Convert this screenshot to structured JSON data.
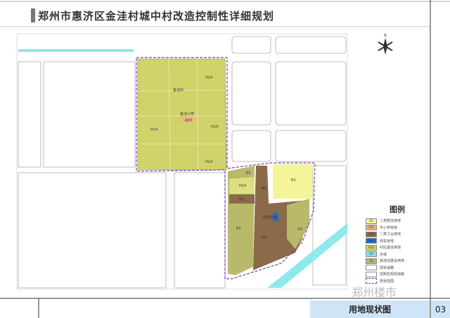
{
  "title": "郑州市惠济区金洼村城中村改造控制性详细规划",
  "sheet_name": "用地现状图",
  "sheet_number": "03",
  "watermark": "郑州楼市",
  "north_arrow": "north-arrow-icon",
  "map_labels": {
    "village": "金洼村",
    "school": "金洼小学",
    "school_code": "A33",
    "h14": "H14",
    "r2": "R2",
    "m2": "M2",
    "e3": "E3",
    "parking": "停车用地"
  },
  "legend": {
    "title": "图例",
    "items": [
      {
        "code": "R2",
        "label": "二类居住用地",
        "color": "#f4f59a"
      },
      {
        "code": "A33",
        "label": "中小学用地",
        "color": "#f0b47a"
      },
      {
        "code": "M2",
        "label": "二类工业用地",
        "color": "#8a6a48"
      },
      {
        "code": "S42",
        "label": "停车用地",
        "color": "#1d6fd6"
      },
      {
        "code": "H14",
        "label": "村庄建设用地",
        "color": "#cfd36a"
      },
      {
        "code": "E1",
        "label": "水域",
        "color": "#7fe7ea"
      },
      {
        "code": "E3",
        "label": "其他非建设用地",
        "color": "#b9b96a"
      },
      {
        "code": "",
        "label": "现状道路",
        "color": "#ffffff"
      },
      {
        "code": "",
        "label": "控制性规划道路",
        "color": "#ffffff"
      },
      {
        "code": "",
        "label": "规划范围",
        "color": "#ffffff"
      }
    ]
  }
}
